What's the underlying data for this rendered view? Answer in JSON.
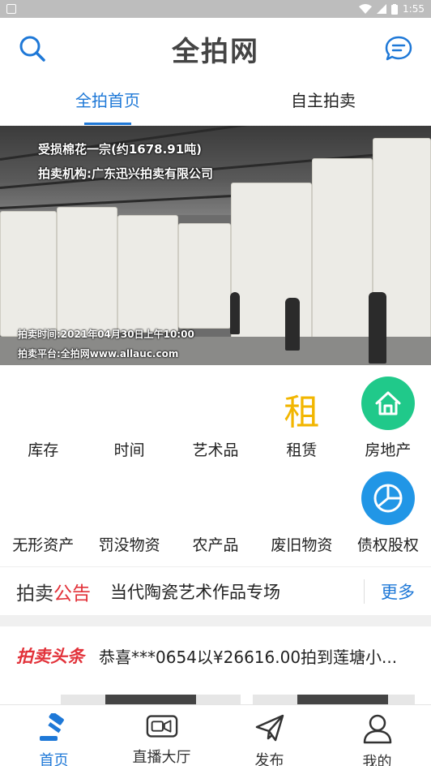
{
  "status_bar": {
    "time": "1:55"
  },
  "header": {
    "title": "全拍网",
    "search_icon": "search-icon",
    "message_icon": "chat-bubble-icon"
  },
  "tabs": [
    {
      "label": "全拍首页",
      "active": true
    },
    {
      "label": "自主拍卖",
      "active": false
    }
  ],
  "banner": {
    "line1": "受损棉花一宗(约1678.91吨)",
    "line2": "拍卖机构:广东迅兴拍卖有限公司",
    "line3": "拍卖时间:2021年04月30日上午10:00",
    "line4": "拍卖平台:全拍网www.allauc.com"
  },
  "categories": {
    "row1": [
      {
        "label": "库存",
        "icon": ""
      },
      {
        "label": "时间",
        "icon": ""
      },
      {
        "label": "艺术品",
        "icon": ""
      },
      {
        "label": "租赁",
        "icon": "rent-char",
        "icon_text": "租"
      },
      {
        "label": "房地产",
        "icon": "house-icon",
        "color": "#20c98a"
      }
    ],
    "row2": [
      {
        "label": "无形资产",
        "icon": ""
      },
      {
        "label": "罚没物资",
        "icon": ""
      },
      {
        "label": "农产品",
        "icon": ""
      },
      {
        "label": "废旧物资",
        "icon": ""
      },
      {
        "label": "债权股权",
        "icon": "pie-chart-icon",
        "color": "#2196e6"
      }
    ]
  },
  "notice": {
    "tag_black": "拍卖",
    "tag_red": "公告",
    "text": "当代陶瓷艺术作品专场",
    "more": "更多"
  },
  "headline": {
    "tag": "拍卖头条",
    "text": "恭喜***0654以¥26616.00拍到莲塘小..."
  },
  "bottom_nav": [
    {
      "label": "首页",
      "icon": "gavel-icon",
      "active": true
    },
    {
      "label": "直播大厅",
      "icon": "video-icon",
      "active": false
    },
    {
      "label": "发布",
      "icon": "paper-plane-icon",
      "active": false
    },
    {
      "label": "我的",
      "icon": "user-icon",
      "active": false
    }
  ],
  "colors": {
    "accent": "#1e78d7",
    "red": "#e2323a",
    "rent": "#f2b600",
    "house": "#20c98a",
    "debt": "#2196e6"
  }
}
